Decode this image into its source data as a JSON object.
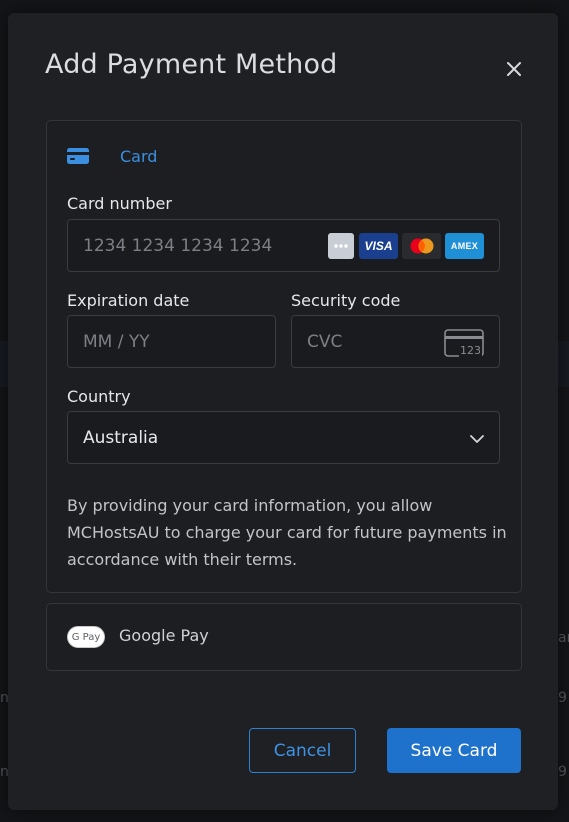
{
  "modal": {
    "title": "Add Payment Method"
  },
  "card_tab": {
    "label": "Card",
    "icon": "credit-card-icon",
    "accent": "#3b8fe0"
  },
  "card_number": {
    "label": "Card number",
    "placeholder": "1234 1234 1234 1234",
    "value": "",
    "brands": [
      "generic-card-icon",
      "visa-icon",
      "mastercard-icon",
      "amex-icon"
    ],
    "brand_texts": {
      "visa": "VISA",
      "amex": "AMEX"
    }
  },
  "expiration": {
    "label": "Expiration date",
    "placeholder": "MM / YY",
    "value": ""
  },
  "security_code": {
    "label": "Security code",
    "placeholder": "CVC",
    "value": "",
    "icon": "cvc-card-icon",
    "icon_text": "123"
  },
  "country": {
    "label": "Country",
    "selected": "Australia"
  },
  "disclaimer": "By providing your card information, you allow MCHostsAU to charge your card for future payments in accordance with their terms.",
  "google_pay": {
    "label": "Google Pay",
    "badge": "G Pay"
  },
  "actions": {
    "cancel": "Cancel",
    "save": "Save Card"
  },
  "colors": {
    "modal_bg": "#1f2024",
    "primary": "#1f72cc",
    "accent_text": "#3e93e6",
    "border": "#3a3c41"
  }
}
